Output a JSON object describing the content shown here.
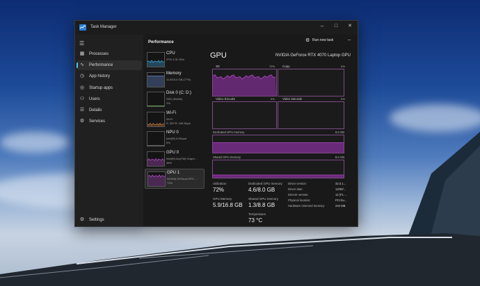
{
  "window": {
    "title": "Task Manager",
    "controls": [
      "–",
      "□",
      "✕"
    ]
  },
  "sidebar": {
    "items": [
      {
        "label": "Processes",
        "icon": "processes-icon",
        "glyph": "▦"
      },
      {
        "label": "Performance",
        "icon": "performance-icon",
        "glyph": "∿",
        "active": true
      },
      {
        "label": "App history",
        "icon": "history-icon",
        "glyph": "◷"
      },
      {
        "label": "Startup apps",
        "icon": "startup-icon",
        "glyph": "◎"
      },
      {
        "label": "Users",
        "icon": "users-icon",
        "glyph": "⚇"
      },
      {
        "label": "Details",
        "icon": "details-icon",
        "glyph": "☰"
      },
      {
        "label": "Services",
        "icon": "services-icon",
        "glyph": "⚙"
      }
    ],
    "settings_label": "Settings"
  },
  "header": {
    "title": "Performance",
    "run_task_label": "Run new task",
    "more_label": "···"
  },
  "devices": [
    {
      "name": "CPU",
      "sub": "37%  3.31 GHz",
      "sub2": "",
      "kind": "cpu"
    },
    {
      "name": "Memory",
      "sub": "11.8/15.4 GB (77%)",
      "sub2": "",
      "kind": "memory"
    },
    {
      "name": "Disk 0 (C: D:)",
      "sub": "SSD (NVMe)",
      "sub2": "1%",
      "kind": "disk"
    },
    {
      "name": "Wi-Fi",
      "sub": "Wi-Fi",
      "sub2": "S: 320  R: 448 Kbps",
      "kind": "wifi"
    },
    {
      "name": "NPU 0",
      "sub": "Intel(R) AI Boost",
      "sub2": "0%",
      "kind": "npu"
    },
    {
      "name": "GPU 0",
      "sub": "Intel(R) Arc(TM) Graph...",
      "sub2": "45%",
      "kind": "gpu0"
    },
    {
      "name": "GPU 1",
      "sub": "NVIDIA GeForce RTX ...",
      "sub2": "72%",
      "kind": "gpu1",
      "active": true
    }
  ],
  "gpu": {
    "title": "GPU",
    "model": "NVIDIA GeForce RTX 4070 Laptop GPU",
    "engines": [
      {
        "label": "3D",
        "pct": "72%",
        "level": 0.72
      },
      {
        "label": "Copy",
        "pct": "0%",
        "level": 0
      },
      {
        "label": "Video Encode",
        "pct": "0%",
        "level": 0
      },
      {
        "label": "Video Decode",
        "pct": "0%",
        "level": 0
      }
    ],
    "dedicated_label": "Dedicated GPU memory",
    "dedicated_max": "8.0 GB",
    "dedicated_level": 0.58,
    "shared_label": "Shared GPU memory",
    "shared_max": "8.0 GB",
    "shared_level": 0.16,
    "stats": {
      "utilization_label": "Utilization",
      "utilization": "72%",
      "dedicated_mem_label": "Dedicated GPU memory",
      "dedicated_mem": "4.6/8.0 GB",
      "gpu_memory_label": "GPU Memory",
      "gpu_memory": "5.9/16.8 GB",
      "shared_mem_label": "Shared GPU memory",
      "shared_mem": "1.3/8.8 GB",
      "temperature_label": "Temperature",
      "temperature": "73 °C"
    },
    "details": [
      {
        "k": "Driver version:",
        "v": "32.0.1..."
      },
      {
        "k": "Driver date:",
        "v": "12/20/..."
      },
      {
        "k": "DirectX version:",
        "v": "12 (FL ..."
      },
      {
        "k": "Physical location:",
        "v": "PCI bu..."
      },
      {
        "k": "Hardware reserved memory:",
        "v": "244 MB"
      }
    ]
  },
  "colors": {
    "accent": "#4cc2ff",
    "gpu_line": "#b04cc6",
    "gpu_fill": "#6a2a7a",
    "cpu_line": "#3fa7e0",
    "mem_line": "#6d8ed6",
    "disk_line": "#6cc05c",
    "wifi_line": "#c37d3d"
  }
}
